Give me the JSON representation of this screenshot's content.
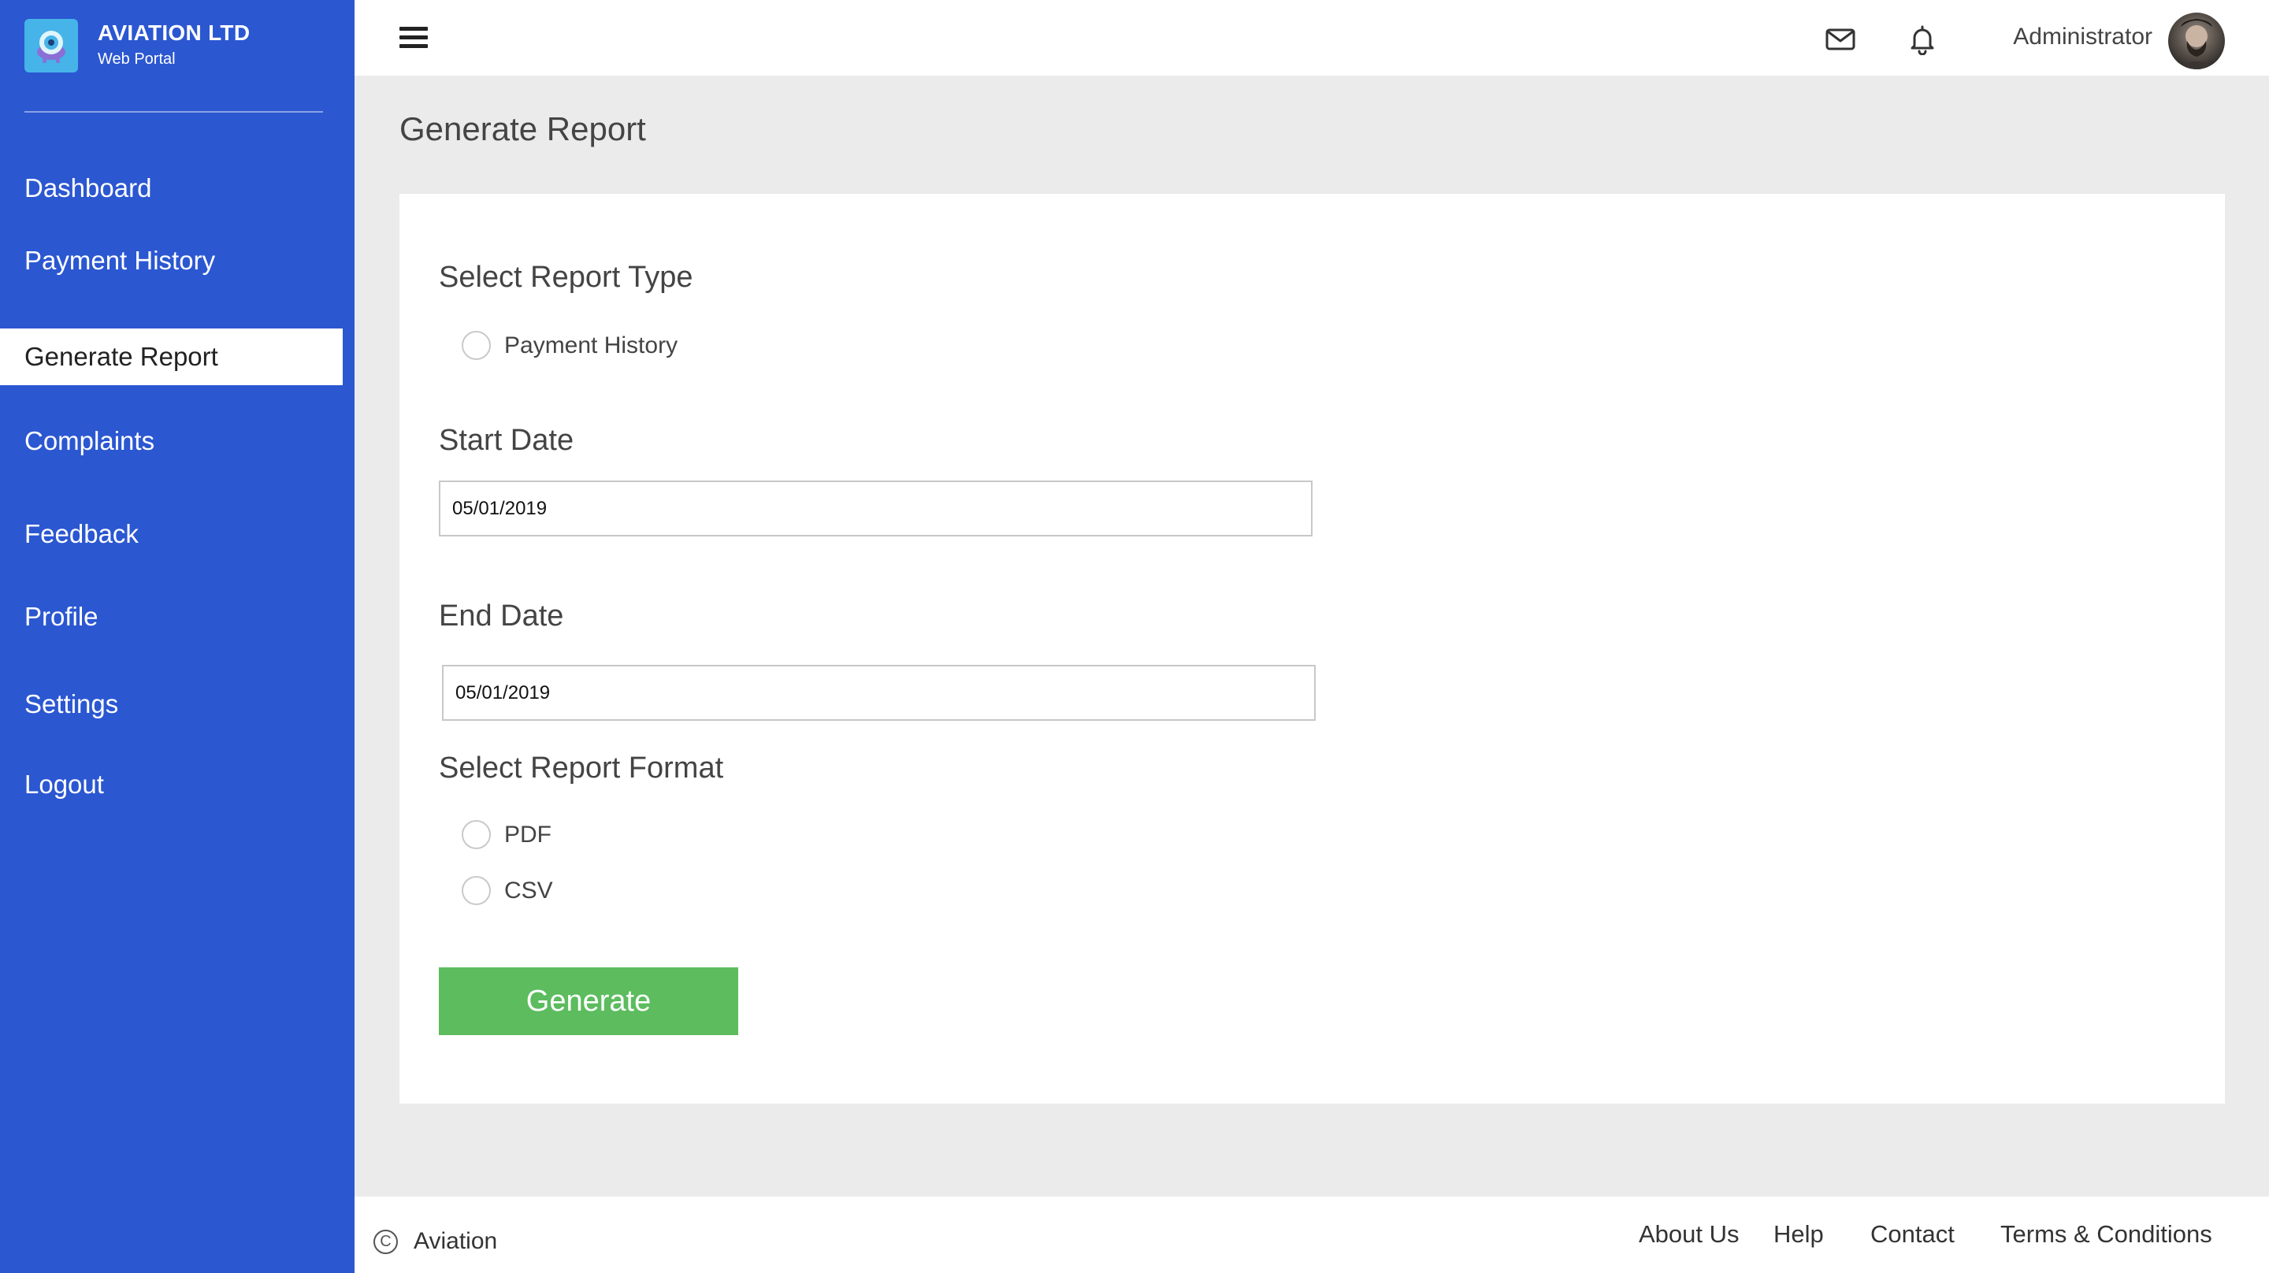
{
  "brand": {
    "title": "AVIATION LTD",
    "subtitle": "Web Portal",
    "logo_icon": "aviation-logo-icon"
  },
  "sidebar": {
    "accent_color": "#2b57d1",
    "items": [
      {
        "label": "Dashboard",
        "active": false
      },
      {
        "label": "Payment History",
        "active": false
      },
      {
        "label": "Generate Report",
        "active": true
      },
      {
        "label": "Complaints",
        "active": false
      },
      {
        "label": "Feedback",
        "active": false
      },
      {
        "label": "Profile",
        "active": false
      },
      {
        "label": "Settings",
        "active": false
      },
      {
        "label": "Logout",
        "active": false
      }
    ]
  },
  "header": {
    "menu_icon": "hamburger-menu-icon",
    "mail_icon": "mail-icon",
    "bell_icon": "bell-icon",
    "user_name": "Administrator"
  },
  "page": {
    "title": "Generate Report"
  },
  "form": {
    "report_type_label": "Select Report Type",
    "report_types": [
      {
        "label": "Payment History",
        "checked": false
      }
    ],
    "start_date_label": "Start Date",
    "start_date_value": "05/01/2019",
    "end_date_label": "End Date",
    "end_date_value": "05/01/2019",
    "format_label": "Select Report Format",
    "formats": [
      {
        "label": "PDF",
        "checked": false
      },
      {
        "label": "CSV",
        "checked": false
      }
    ],
    "generate_label": "Generate",
    "generate_color": "#5cbc5e"
  },
  "footer": {
    "copyright_symbol": "C",
    "copyright_text": "Aviation",
    "links": [
      "About Us",
      "Help",
      "Contact",
      "Terms & Conditions"
    ]
  }
}
